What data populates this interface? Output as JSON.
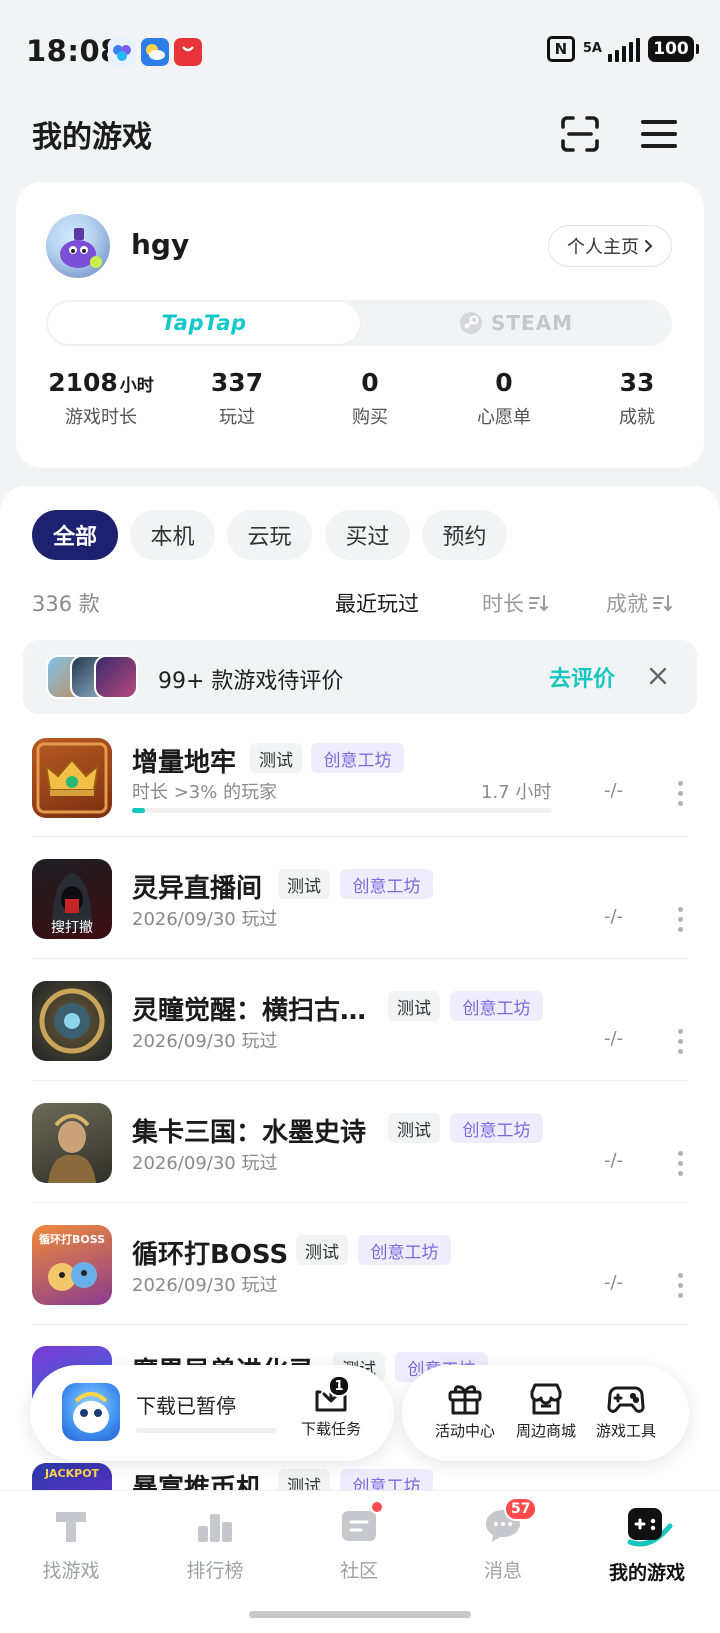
{
  "status_bar": {
    "time": "18:08",
    "network": "5A",
    "battery": "100"
  },
  "header": {
    "title": "我的游戏"
  },
  "profile": {
    "username": "hgy",
    "homepage_button": "个人主页",
    "platform_tabs": [
      "TapTap",
      "STEAM"
    ],
    "active_platform": "TapTap",
    "stats": [
      {
        "value": "2108",
        "unit": "小时",
        "label": "游戏时长"
      },
      {
        "value": "337",
        "unit": "",
        "label": "玩过"
      },
      {
        "value": "0",
        "unit": "",
        "label": "购买"
      },
      {
        "value": "0",
        "unit": "",
        "label": "心愿单"
      },
      {
        "value": "33",
        "unit": "",
        "label": "成就"
      }
    ]
  },
  "filters": {
    "chips": [
      "全部",
      "本机",
      "云玩",
      "买过",
      "预约"
    ],
    "active": "全部",
    "count_label": "336 款",
    "sort_options": [
      "最近玩过",
      "时长",
      "成就"
    ],
    "active_sort": "最近玩过"
  },
  "review_banner": {
    "text": "99+ 款游戏待评价",
    "action": "去评价"
  },
  "games": [
    {
      "name": "增量地牢",
      "tags": [
        "测试",
        "创意工坊"
      ],
      "sub": "时长 >3% 的玩家",
      "hours": "1.7 小时",
      "score": "-/-",
      "progress": 0.03
    },
    {
      "name": "灵异直播间",
      "tags": [
        "测试",
        "创意工坊"
      ],
      "sub": "2026/09/30 玩过",
      "score": "-/-",
      "icon_text": "搜打撤"
    },
    {
      "name": "灵瞳觉醒：横扫古…",
      "tags": [
        "测试",
        "创意工坊"
      ],
      "sub": "2026/09/30 玩过",
      "score": "-/-"
    },
    {
      "name": "集卡三国：水墨史诗",
      "tags": [
        "测试",
        "创意工坊"
      ],
      "sub": "2026/09/30 玩过",
      "score": "-/-"
    },
    {
      "name": "循环打BOSS",
      "tags": [
        "测试",
        "创意工坊"
      ],
      "sub": "2026/09/30 玩过",
      "score": "-/-",
      "icon_text": "循环打BOSS"
    },
    {
      "name": "魔界异兽进化录",
      "tags": [
        "测试",
        "创意工坊"
      ]
    },
    {
      "name": "暴富推币机",
      "tags": [
        "测试",
        "创意工坊"
      ],
      "icon_text": "JACKPOT"
    }
  ],
  "download": {
    "status": "下载已暂停",
    "task_label": "下载任务",
    "task_count": "1"
  },
  "tools": [
    "活动中心",
    "周边商城",
    "游戏工具"
  ],
  "bottom_nav": {
    "items": [
      "找游戏",
      "排行榜",
      "社区",
      "消息",
      "我的游戏"
    ],
    "active": "我的游戏",
    "message_badge": "57"
  },
  "colors": {
    "accent_teal": "#16c6bf",
    "chip_active": "#1d2170",
    "workshop_tag": "#7a6ae0",
    "badge_red": "#ff4b4b"
  }
}
